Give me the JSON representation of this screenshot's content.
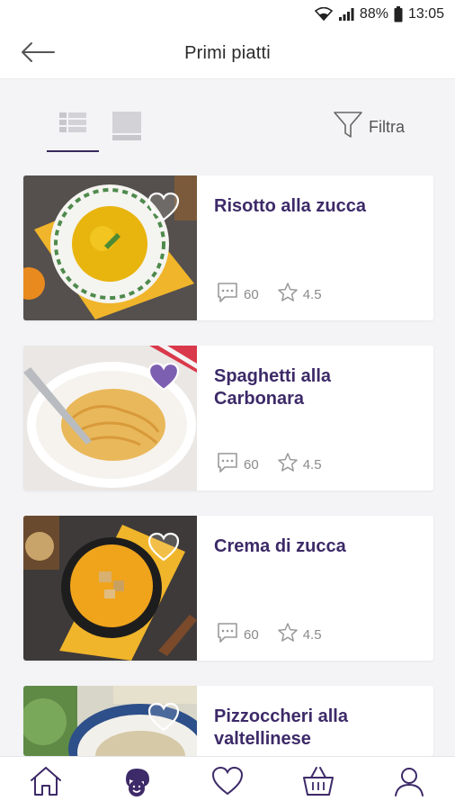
{
  "status_bar": {
    "battery": "88%",
    "time": "13:05",
    "icons": [
      "wifi-icon",
      "signal-icon",
      "battery-icon"
    ]
  },
  "header": {
    "title": "Primi piatti",
    "back_icon": "arrow-left-icon"
  },
  "toolbar": {
    "view_list_icon": "list-view-icon",
    "view_grid_icon": "grid-view-icon",
    "active_view": "list",
    "filter_label": "Filtra",
    "filter_icon": "funnel-icon"
  },
  "recipes": [
    {
      "title": "Risotto alla zucca",
      "comments": "60",
      "rating": "4.5",
      "favorite": false
    },
    {
      "title": "Spaghetti alla Carbonara",
      "comments": "60",
      "rating": "4.5",
      "favorite": true
    },
    {
      "title": "Crema di zucca",
      "comments": "60",
      "rating": "4.5",
      "favorite": false
    },
    {
      "title": "Pizzoccheri alla valtellinese",
      "comments": "",
      "rating": "",
      "favorite": false
    }
  ],
  "bottom_nav": {
    "items": [
      "home-icon",
      "chef-icon",
      "heart-icon",
      "basket-icon",
      "user-icon"
    ],
    "active": "chef-icon"
  },
  "colors": {
    "accent": "#3d2a68",
    "favorite_fill": "#7d5fb2",
    "background": "#f4f4f6"
  }
}
